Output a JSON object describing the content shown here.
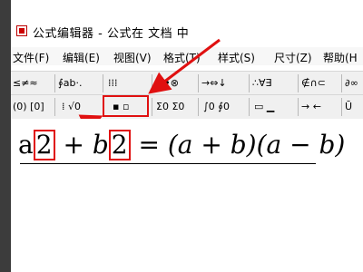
{
  "window": {
    "title": "公式编辑器 - 公式在 文档 中"
  },
  "menu": {
    "items": [
      "文件(F)",
      "编辑(E)",
      "视图(V)",
      "格式(T)",
      "样式(S)",
      "尺寸(Z)",
      "帮助(H"
    ]
  },
  "toolbar": {
    "row1": [
      "≤≠≈",
      "∮ab·.",
      "⁞⁞⁞",
      "±•⊗",
      "→⇔↓",
      "∴∀∃",
      "∉∩⊂",
      "∂∞"
    ],
    "row2": [
      "(0) [0]",
      "⁞ √0",
      "▪ ▫",
      "Σ0 Σ0",
      "∫0 ∮0",
      "▭ ▁",
      "→ ←",
      "Ū"
    ]
  },
  "equation": {
    "a": "a",
    "exp1": "2",
    "plus": "+",
    "b": "b",
    "exp2": "2",
    "rhs": "= (a + b)(a − b)"
  },
  "colors": {
    "highlight": "#e01010",
    "arrow": "#e01010"
  },
  "icons": {
    "app": "equation-editor-icon"
  }
}
